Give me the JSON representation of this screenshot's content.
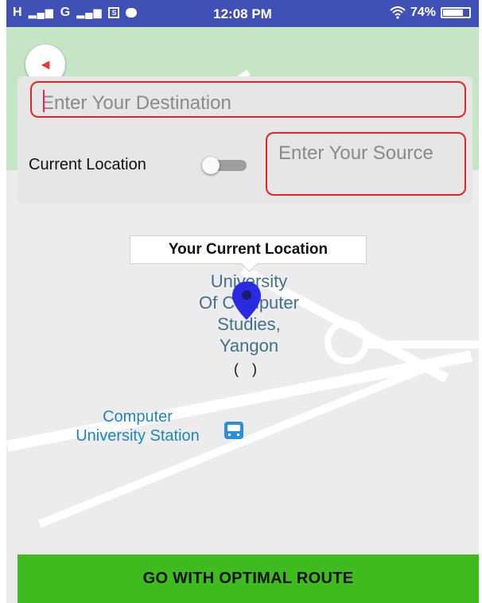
{
  "status_bar": {
    "signal_1": "H",
    "signal_2": "G",
    "time": "12:08 PM",
    "battery": "74%",
    "battery_level": 0.74,
    "background": "#3f51b5"
  },
  "form": {
    "destination_placeholder": "Enter Your Destination",
    "current_location_label": "Current Location",
    "current_location_toggle_on": false,
    "source_placeholder": "Enter Your Source"
  },
  "map": {
    "tooltip": "Your Current Location",
    "poi_lines": [
      "University",
      "Of Computer",
      "Studies,",
      "Yangon"
    ],
    "parens": "( )",
    "station_lines": [
      "Computer",
      "University Station"
    ],
    "marker_color": "#2a2ae0"
  },
  "action": {
    "button_label": "GO WITH OPTIMAL ROUTE",
    "button_color": "#3dbb1f"
  },
  "icons": {
    "compass": "compass-icon",
    "bus": "bus-station-icon",
    "marker": "location-marker-icon",
    "wifi": "wifi-icon",
    "battery": "battery-icon"
  }
}
